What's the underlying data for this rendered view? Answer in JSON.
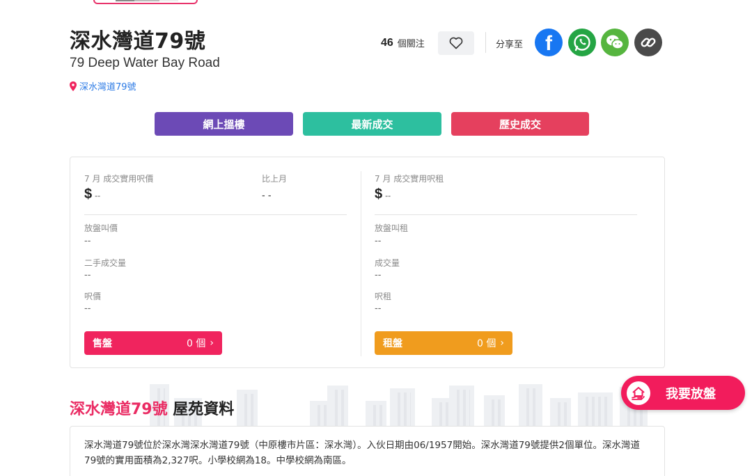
{
  "header": {
    "title": "深水灣道79號",
    "subtitle": "79 Deep Water Bay Road",
    "location": "深水灣道79號"
  },
  "follow": {
    "count": "46",
    "label": "個關注"
  },
  "share": {
    "label": "分享至",
    "icons": [
      "facebook-icon",
      "whatsapp-icon",
      "wechat-icon",
      "link-icon"
    ]
  },
  "actions": {
    "online": "網上搵樓",
    "latest": "最新成交",
    "history": "歷史成交"
  },
  "stats": {
    "left": {
      "price_label": "7 月 成交實用呎價",
      "price_symbol": "$",
      "price_value": "--",
      "mom_label": "比上月",
      "mom_value": "- -",
      "ask_label": "放盤叫價",
      "ask_value": "--",
      "volume_label": "二手成交量",
      "volume_value": "--",
      "psf_label": "呎價",
      "psf_value": "--",
      "cta_label": "售盤",
      "cta_count": "0 個"
    },
    "right": {
      "price_label": "7 月 成交實用呎租",
      "price_symbol": "$",
      "price_value": "--",
      "ask_label": "放盤叫租",
      "ask_value": "--",
      "volume_label": "成交量",
      "volume_value": "--",
      "psf_label": "呎租",
      "psf_value": "--",
      "cta_label": "租盤",
      "cta_count": "0 個"
    }
  },
  "section": {
    "title_highlight": "深水灣道79號",
    "title_rest": " 屋苑資料"
  },
  "fab": {
    "label": "我要放盤"
  },
  "description": "深水灣道79號位於深水灣深水灣道79號（中原樓市片區：深水灣）。入伙日期由06/1957開始。深水灣道79號提供2個單位。深水灣道79號的實用面積為2,327呎。小學校網為18。中學校網為南區。",
  "colors": {
    "brand": "#f21c5c",
    "online": "#6c4ab6",
    "latest": "#2dbf9f",
    "history": "#e5405e",
    "rent": "#f09c1e",
    "link": "#2d7be5"
  }
}
